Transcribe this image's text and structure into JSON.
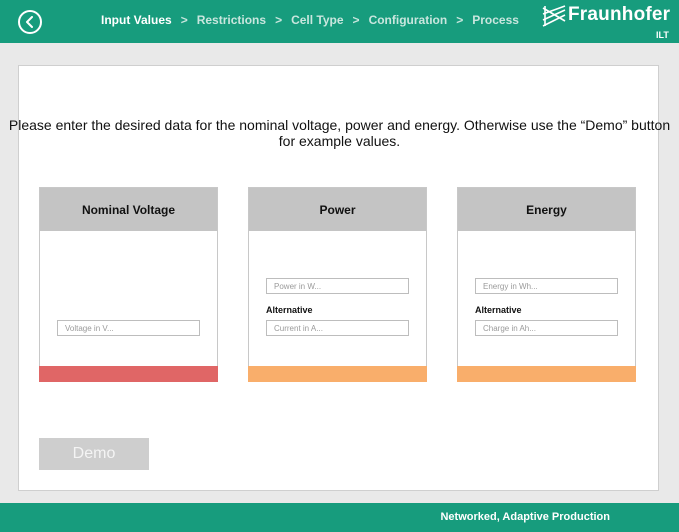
{
  "colors": {
    "brand": "#179c7d",
    "voltage_bar": "#e06666",
    "power_bar": "#f9ae6b",
    "energy_bar": "#f9ae6b",
    "card_header": "#c4c4c4"
  },
  "header": {
    "back_icon": "chevron-left-icon",
    "steps": [
      {
        "label": "Input Values",
        "active": true
      },
      {
        "label": "Restrictions",
        "active": false
      },
      {
        "label": "Cell Type",
        "active": false
      },
      {
        "label": "Configuration",
        "active": false
      },
      {
        "label": "Process",
        "active": false
      }
    ],
    "separator": ">",
    "logo": {
      "name": "Fraunhofer",
      "sub": "ILT"
    }
  },
  "main": {
    "intro_text": "Please enter the desired data for the nominal voltage, power and energy. Otherwise use the “Demo” button for example values.",
    "cards": {
      "voltage": {
        "title": "Nominal Voltage",
        "fields": [
          {
            "placeholder": "Voltage in V..."
          }
        ]
      },
      "power": {
        "title": "Power",
        "fields": [
          {
            "placeholder": "Power in W..."
          },
          {
            "placeholder": "Current in A..."
          }
        ],
        "alternative_label": "Alternative"
      },
      "energy": {
        "title": "Energy",
        "fields": [
          {
            "placeholder": "Energy in Wh..."
          },
          {
            "placeholder": "Charge in Ah..."
          }
        ],
        "alternative_label": "Alternative"
      }
    },
    "demo_button": "Demo"
  },
  "footer": {
    "text": "Networked, Adaptive Production"
  }
}
